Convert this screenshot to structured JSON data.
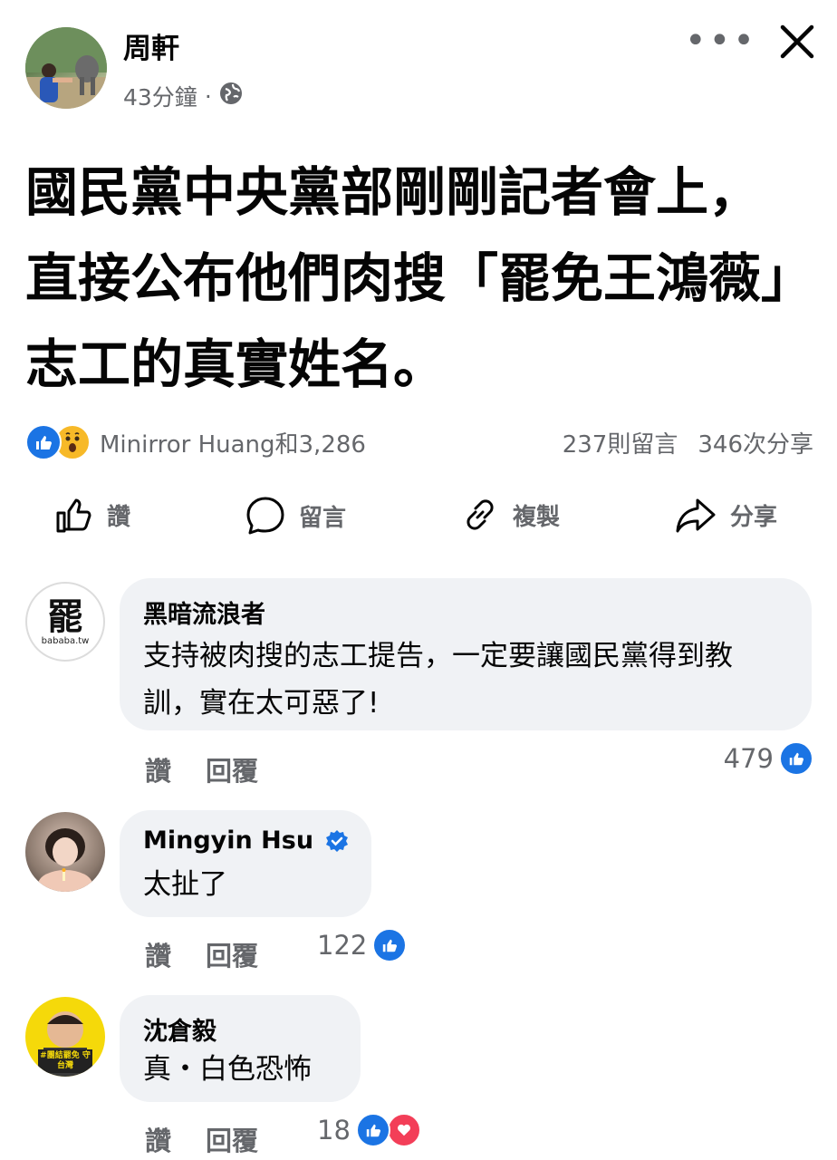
{
  "post": {
    "author": "周軒",
    "time": "43分鐘",
    "separator": "·",
    "text": "國民黨中央黨部剛剛記者會上，直接公布他們肉搜「罷免王鴻薇」志工的真實姓名。",
    "reactions_text": "Minirror Huang和3,286",
    "comments_count": "237則留言",
    "shares_count": "346次分享"
  },
  "actions": {
    "like": "讚",
    "comment": "留言",
    "copy": "複製",
    "share": "分享"
  },
  "comments": [
    {
      "name": "黑暗流浪者",
      "avatar_text": "罷",
      "avatar_sub": "bababa.tw",
      "text": "支持被肉搜的志工提告，一定要讓國民黨得到教訓，實在太可惡了!",
      "like": "讚",
      "reply": "回覆",
      "count": "479"
    },
    {
      "name": "Mingyin Hsu",
      "text": "太扯了",
      "like": "讚",
      "reply": "回覆",
      "count": "122"
    },
    {
      "name": "沈倉毅",
      "avatar_text": "#團結罷免 守台灣",
      "text": "真・白色恐怖",
      "like": "讚",
      "reply": "回覆",
      "count": "18"
    }
  ],
  "colors": {
    "brand_blue": "#1b74e4",
    "secondary_text": "#65676b",
    "bubble_bg": "#f0f2f5",
    "love_red": "#f33e58",
    "wow_yellow": "#f7b928"
  }
}
